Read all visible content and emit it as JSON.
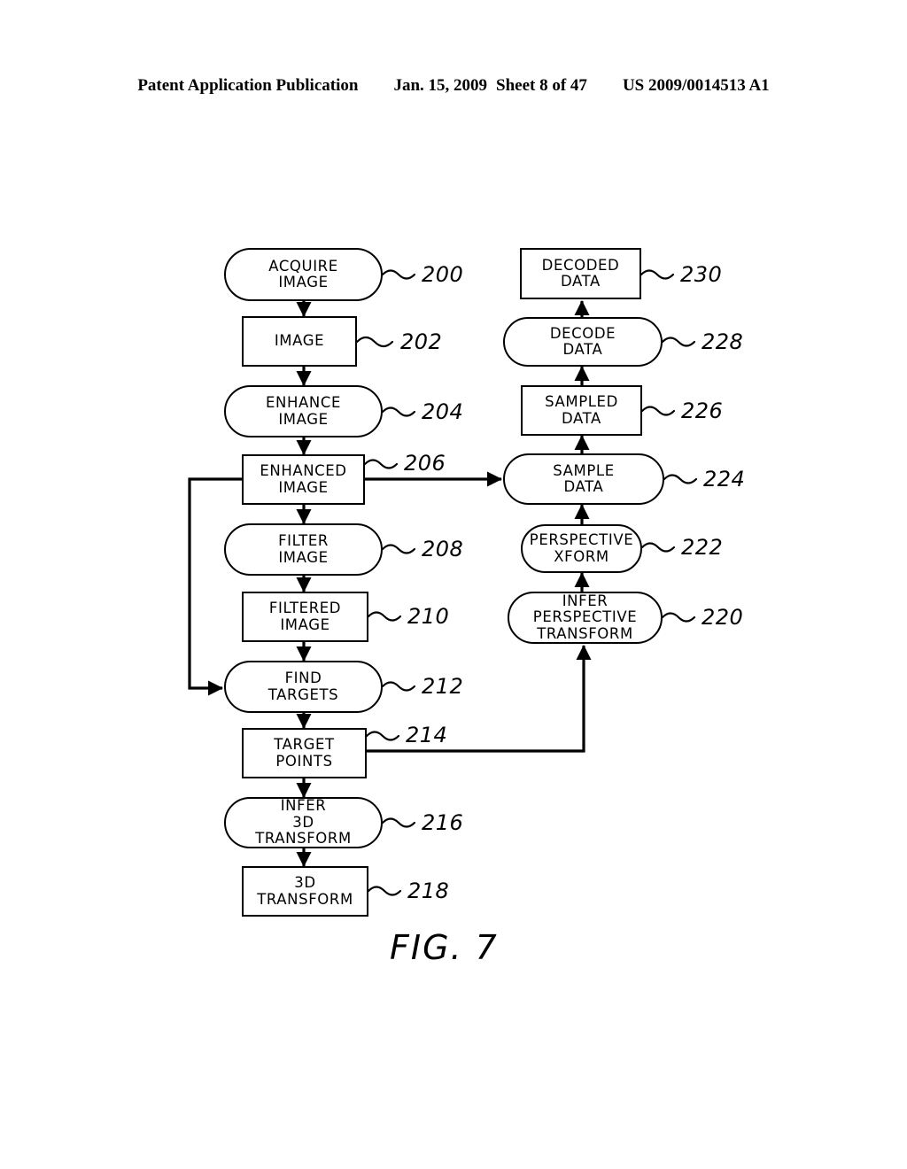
{
  "header": {
    "publication": "Patent Application Publication",
    "date": "Jan. 15, 2009",
    "sheet": "Sheet 8 of 47",
    "docnum": "US 2009/0014513 A1"
  },
  "figure": {
    "caption": "FIG. 7",
    "ink_color": "#000000",
    "background_color": "#ffffff"
  },
  "chart_data": {
    "type": "diagram",
    "title": "FIG. 7",
    "subtype": "flowchart",
    "node_shapes": {
      "process": "rounded-rectangle",
      "data": "rectangle"
    },
    "nodes": [
      {
        "id": "200",
        "label": "ACQUIRE IMAGE",
        "lines": [
          "ACQUIRE",
          "IMAGE"
        ],
        "shape": "process",
        "column": "left"
      },
      {
        "id": "202",
        "label": "IMAGE",
        "lines": [
          "IMAGE"
        ],
        "shape": "data",
        "column": "left"
      },
      {
        "id": "204",
        "label": "ENHANCE IMAGE",
        "lines": [
          "ENHANCE",
          "IMAGE"
        ],
        "shape": "process",
        "column": "left"
      },
      {
        "id": "206",
        "label": "ENHANCED IMAGE",
        "lines": [
          "ENHANCED",
          "IMAGE"
        ],
        "shape": "data",
        "column": "left"
      },
      {
        "id": "208",
        "label": "FILTER IMAGE",
        "lines": [
          "FILTER",
          "IMAGE"
        ],
        "shape": "process",
        "column": "left"
      },
      {
        "id": "210",
        "label": "FILTERED IMAGE",
        "lines": [
          "FILTERED",
          "IMAGE"
        ],
        "shape": "data",
        "column": "left"
      },
      {
        "id": "212",
        "label": "FIND TARGETS",
        "lines": [
          "FIND",
          "TARGETS"
        ],
        "shape": "process",
        "column": "left"
      },
      {
        "id": "214",
        "label": "TARGET POINTS",
        "lines": [
          "TARGET",
          "POINTS"
        ],
        "shape": "data",
        "column": "left"
      },
      {
        "id": "216",
        "label": "INFER 3D TRANSFORM",
        "lines": [
          "INFER",
          "3D",
          "TRANSFORM"
        ],
        "shape": "process",
        "column": "left"
      },
      {
        "id": "218",
        "label": "3D TRANSFORM",
        "lines": [
          "3D",
          "TRANSFORM"
        ],
        "shape": "data",
        "column": "left"
      },
      {
        "id": "220",
        "label": "INFER PERSPECTIVE TRANSFORM",
        "lines": [
          "INFER",
          "PERSPECTIVE",
          "TRANSFORM"
        ],
        "shape": "process",
        "column": "right"
      },
      {
        "id": "222",
        "label": "PERSPECTIVE XFORM",
        "lines": [
          "PERSPECTIVE",
          "XFORM"
        ],
        "shape": "process",
        "column": "right"
      },
      {
        "id": "224",
        "label": "SAMPLE DATA",
        "lines": [
          "SAMPLE",
          "DATA"
        ],
        "shape": "process",
        "column": "right"
      },
      {
        "id": "226",
        "label": "SAMPLED DATA",
        "lines": [
          "SAMPLED",
          "DATA"
        ],
        "shape": "data",
        "column": "right"
      },
      {
        "id": "228",
        "label": "DECODE DATA",
        "lines": [
          "DECODE",
          "DATA"
        ],
        "shape": "process",
        "column": "right"
      },
      {
        "id": "230",
        "label": "DECODED DATA",
        "lines": [
          "DECODED",
          "DATA"
        ],
        "shape": "data",
        "column": "right"
      }
    ],
    "edges": [
      {
        "from": "200",
        "to": "202",
        "style": "straight-down"
      },
      {
        "from": "202",
        "to": "204",
        "style": "straight-down"
      },
      {
        "from": "204",
        "to": "206",
        "style": "straight-down"
      },
      {
        "from": "206",
        "to": "208",
        "style": "straight-down"
      },
      {
        "from": "206",
        "to": "212",
        "style": "left-bypass"
      },
      {
        "from": "206",
        "to": "224",
        "style": "right-horizontal"
      },
      {
        "from": "208",
        "to": "210",
        "style": "straight-down"
      },
      {
        "from": "210",
        "to": "212",
        "style": "straight-down"
      },
      {
        "from": "212",
        "to": "214",
        "style": "straight-down"
      },
      {
        "from": "214",
        "to": "216",
        "style": "straight-down"
      },
      {
        "from": "214",
        "to": "220",
        "style": "right-then-up"
      },
      {
        "from": "216",
        "to": "218",
        "style": "straight-down"
      },
      {
        "from": "220",
        "to": "222",
        "style": "straight-up"
      },
      {
        "from": "222",
        "to": "224",
        "style": "straight-up"
      },
      {
        "from": "224",
        "to": "226",
        "style": "straight-up"
      },
      {
        "from": "226",
        "to": "228",
        "style": "straight-up"
      },
      {
        "from": "228",
        "to": "230",
        "style": "straight-up"
      }
    ]
  }
}
